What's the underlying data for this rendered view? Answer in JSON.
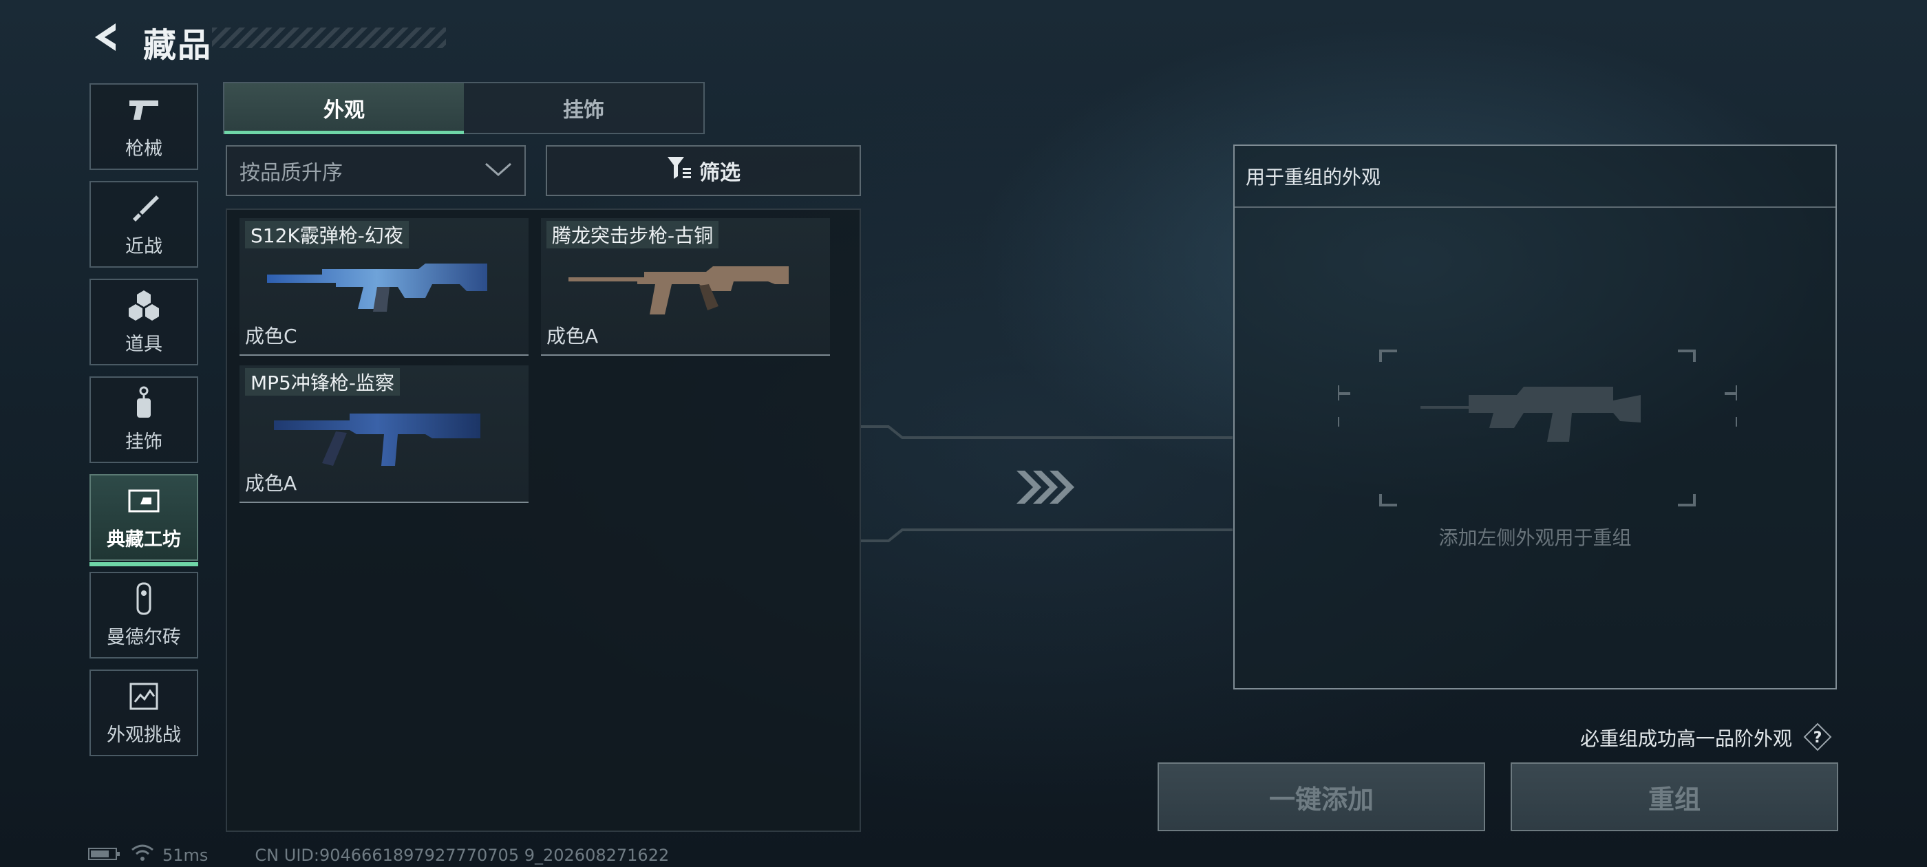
{
  "header": {
    "title": "藏品"
  },
  "sidebar": {
    "items": [
      {
        "label": "枪械",
        "icon": "pistol-icon"
      },
      {
        "label": "近战",
        "icon": "knife-icon"
      },
      {
        "label": "道具",
        "icon": "grenades-icon"
      },
      {
        "label": "挂饰",
        "icon": "charm-icon"
      },
      {
        "label": "典藏工坊",
        "icon": "workshop-icon",
        "active": true
      },
      {
        "label": "曼德尔砖",
        "icon": "brick-icon"
      },
      {
        "label": "外观挑战",
        "icon": "challenge-icon"
      }
    ]
  },
  "tabs": [
    {
      "label": "外观",
      "active": true
    },
    {
      "label": "挂饰",
      "active": false
    }
  ],
  "sort": {
    "value": "按品质升序"
  },
  "filter": {
    "label": "筛选"
  },
  "items": [
    {
      "name": "S12K霰弹枪-幻夜",
      "grade": "成色C"
    },
    {
      "name": "腾龙突击步枪-古铜",
      "grade": "成色A"
    },
    {
      "name": "MP5冲锋枪-监察",
      "grade": "成色A"
    }
  ],
  "recombine": {
    "title": "用于重组的外观",
    "hint": "添加左侧外观用于重组"
  },
  "guarantee_text": "必重组成功高一品阶外观",
  "buttons": {
    "add_all": "一键添加",
    "recombine": "重组"
  },
  "status": {
    "ping": "51ms",
    "uid": "CN UID:9046661897927770705 9_202608271622"
  },
  "colors": {
    "accent": "#6fd6a8"
  }
}
